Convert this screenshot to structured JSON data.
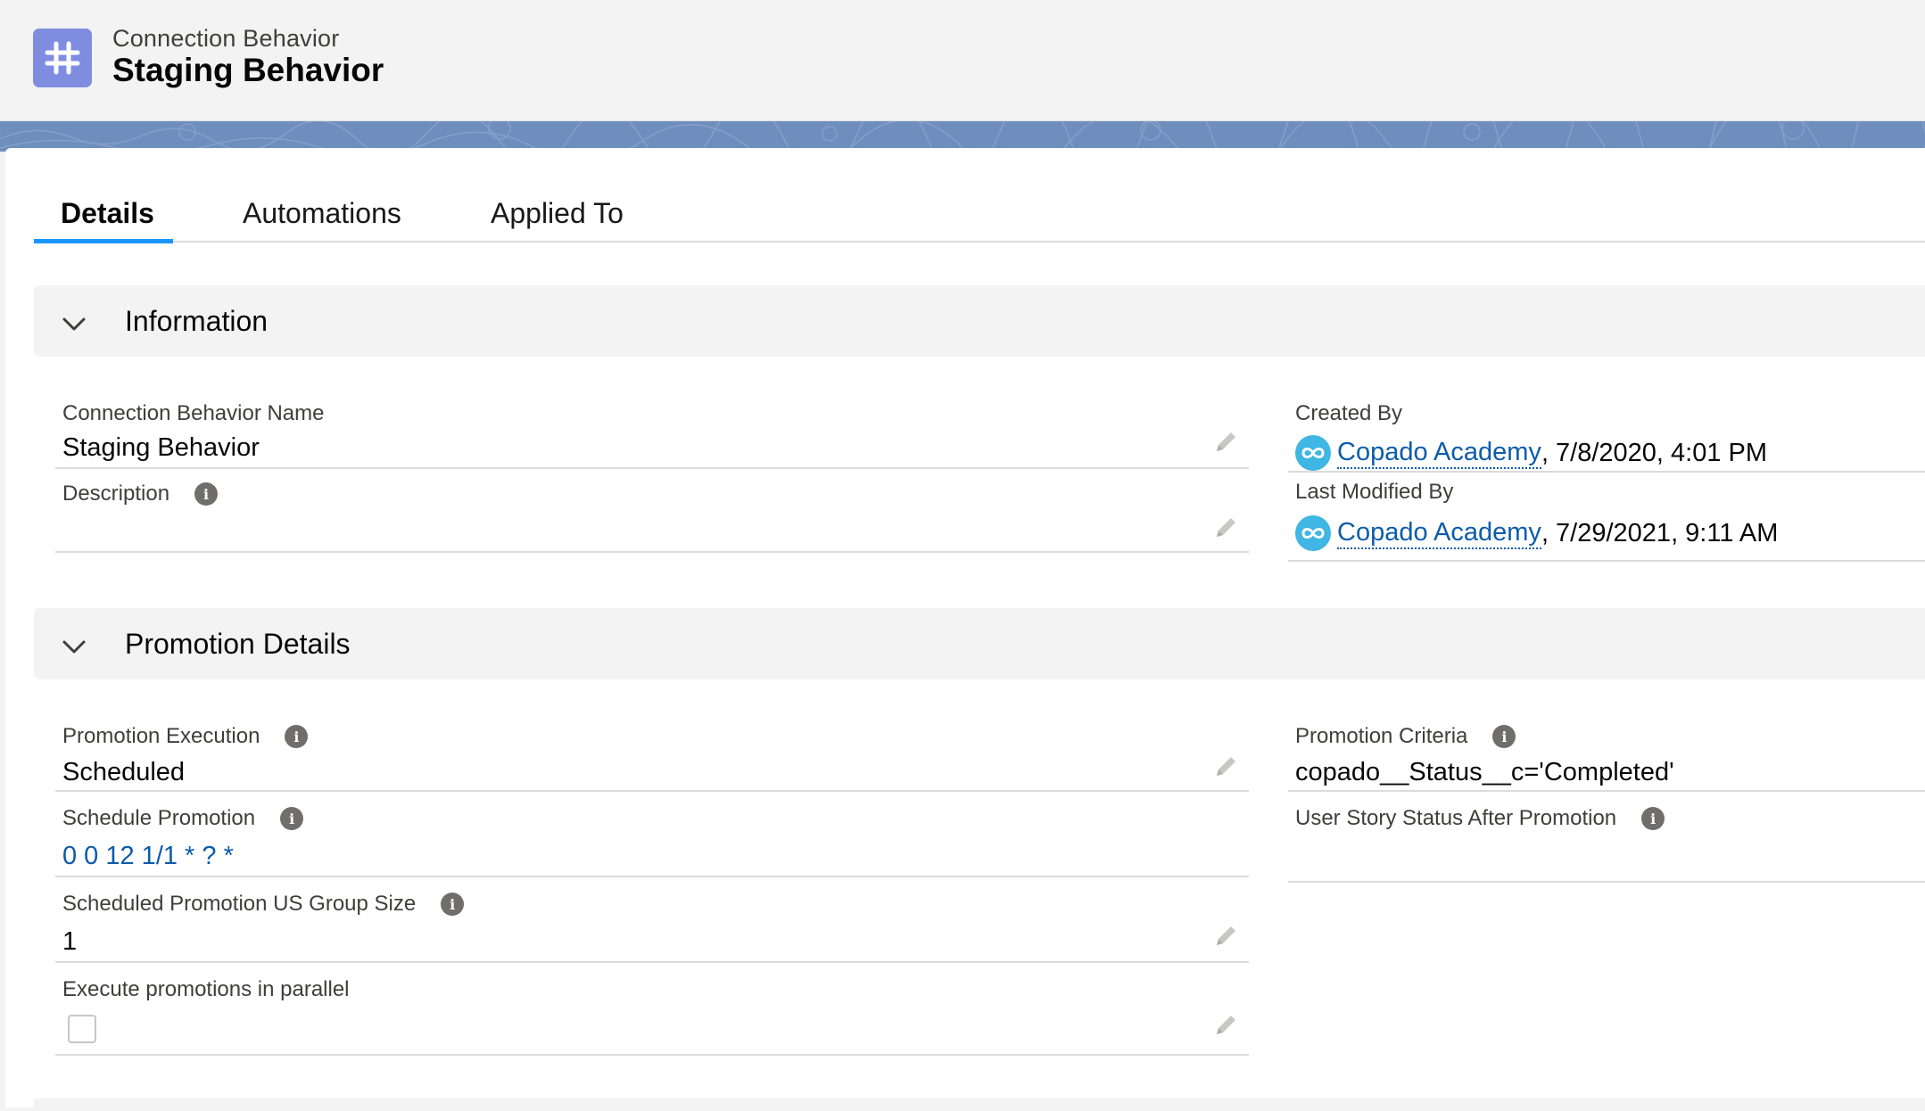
{
  "header": {
    "object_label": "Connection Behavior",
    "record_title": "Staging Behavior",
    "icon": "hash-icon",
    "icon_color": "#7f8de1"
  },
  "tabs": [
    {
      "label": "Details",
      "active": true
    },
    {
      "label": "Automations",
      "active": false
    },
    {
      "label": "Applied To",
      "active": false
    }
  ],
  "sections": {
    "information": {
      "title": "Information",
      "fields": {
        "name": {
          "label": "Connection Behavior Name",
          "value": "Staging Behavior"
        },
        "description": {
          "label": "Description",
          "value": ""
        },
        "created_by": {
          "label": "Created By",
          "user": "Copado Academy",
          "datetime": ", 7/8/2020, 4:01 PM"
        },
        "last_modified_by": {
          "label": "Last Modified By",
          "user": "Copado Academy",
          "datetime": ", 7/29/2021, 9:11 AM"
        }
      }
    },
    "promotion": {
      "title": "Promotion Details",
      "fields": {
        "execution": {
          "label": "Promotion Execution",
          "value": "Scheduled"
        },
        "schedule": {
          "label": "Schedule Promotion",
          "value": "0 0 12 1/1 * ? *"
        },
        "group_size": {
          "label": "Scheduled Promotion US Group Size",
          "value": "1"
        },
        "parallel": {
          "label": "Execute promotions in parallel",
          "checked": false
        },
        "criteria": {
          "label": "Promotion Criteria",
          "value": "copado__Status__c='Completed'"
        },
        "status_after": {
          "label": "User Story Status After Promotion",
          "value": ""
        }
      }
    }
  },
  "colors": {
    "accent": "#1b96ff",
    "link": "#0b5cab",
    "band": "#6e8fbd",
    "avatar": "#3fb6e4"
  }
}
